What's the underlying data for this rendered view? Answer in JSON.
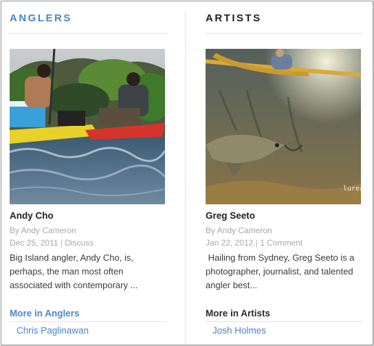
{
  "columns": [
    {
      "heading": "ANGLERS",
      "post_title": "Andy Cho",
      "byline": "By Andy Cameron",
      "date": "Dec 25, 2011",
      "separator": "|",
      "comments": "Discuss",
      "excerpt": "Big Island angler, Andy Cho, is, perhaps, the man most often associated with contemporary ...",
      "more_label": "More in Anglers",
      "related_link": "Chris Paglinawan",
      "image_alt": "Two men paddling kayaks loaded with gear on rough water"
    },
    {
      "heading": "ARTISTS",
      "post_title": "Greg Seeto",
      "byline": "By Andy Cameron",
      "date": "Jan 22, 2012",
      "separator": "|",
      "comments": "1 Comment",
      "excerpt": " Hailing from Sydney, Greg Seeto is a photographer, journalist, and talented angler best...",
      "more_label": "More in Artists",
      "related_link": "Josh Holmes",
      "image_alt": "Underwater photo of a fish with an angler in a kayak above",
      "image_watermark": "lurean"
    }
  ],
  "colors": {
    "accent_blue": "#4a86c6",
    "meta_gray": "#a8a8a8",
    "text_dark": "#3b3b3b"
  }
}
